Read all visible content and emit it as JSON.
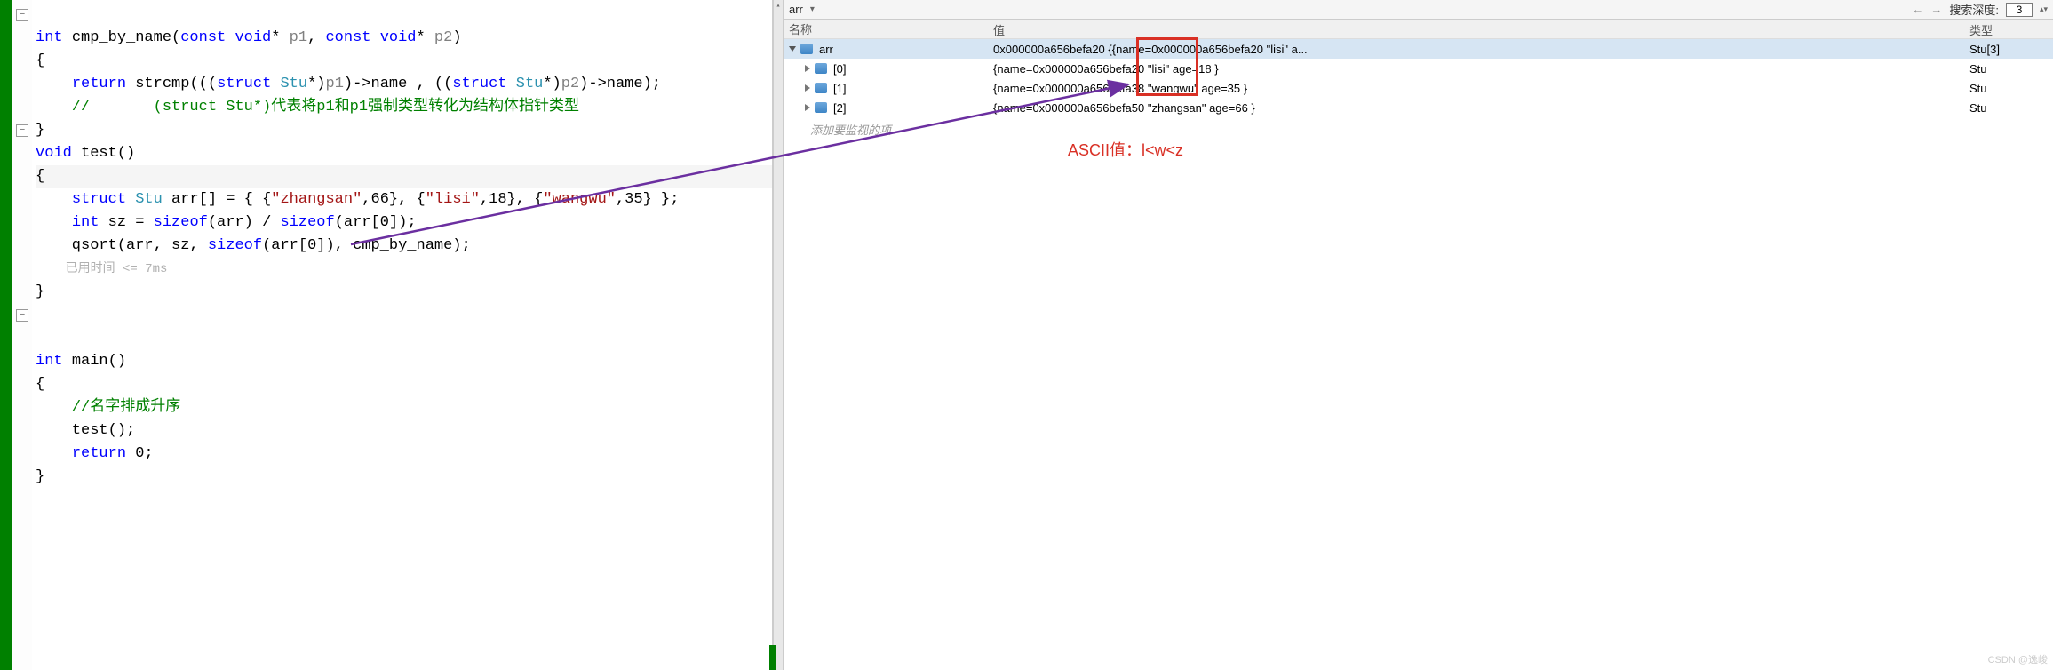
{
  "editor": {
    "lines": {
      "fn_cmp": "int cmp_by_name(const void* p1, const void* p2)",
      "brace_open": "{",
      "ret": "    return strcmp(((struct Stu*)p1)->name , ((struct Stu*)p2)->name);",
      "cmt1": "    //       (struct Stu*)代表将p1和p1强制类型转化为结构体指针类型",
      "brace_close": "}",
      "fn_test": "void test()",
      "arr": "    struct Stu arr[] = { {\"zhangsan\",66}, {\"lisi\",18}, {\"wangwu\",35} };",
      "sz": "    int sz = sizeof(arr) / sizeof(arr[0]);",
      "qsort": "    qsort(arr, sz, sizeof(arr[0]), cmp_by_name);",
      "hint": "    已用时间 <= 7ms",
      "fn_main": "int main()",
      "cmt2": "    //名字排成升序",
      "call": "    test();",
      "ret0": "    return 0;"
    }
  },
  "watch": {
    "toolbar": {
      "expr": "arr",
      "depth_label": "搜索深度:",
      "depth_value": "3"
    },
    "headers": {
      "name": "名称",
      "value": "值",
      "type": "类型"
    },
    "rows": [
      {
        "level": 0,
        "open": true,
        "name": "arr",
        "value": "0x000000a656befa20 {{name=0x000000a656befa20 \"lisi\" a...",
        "type": "Stu[3]"
      },
      {
        "level": 1,
        "open": false,
        "name": "[0]",
        "value": "{name=0x000000a656befa20 \"lisi\" age=18 }",
        "type": "Stu"
      },
      {
        "level": 1,
        "open": false,
        "name": "[1]",
        "value": "{name=0x000000a656befa38 \"wangwu\" age=35 }",
        "type": "Stu"
      },
      {
        "level": 1,
        "open": false,
        "name": "[2]",
        "value": "{name=0x000000a656befa50 \"zhangsan\" age=66 }",
        "type": "Stu"
      }
    ],
    "add_hint": "添加要监视的项"
  },
  "annotation": {
    "ascii_note": "ASCII值：l<w<z"
  },
  "watermark": "CSDN @逸峻"
}
